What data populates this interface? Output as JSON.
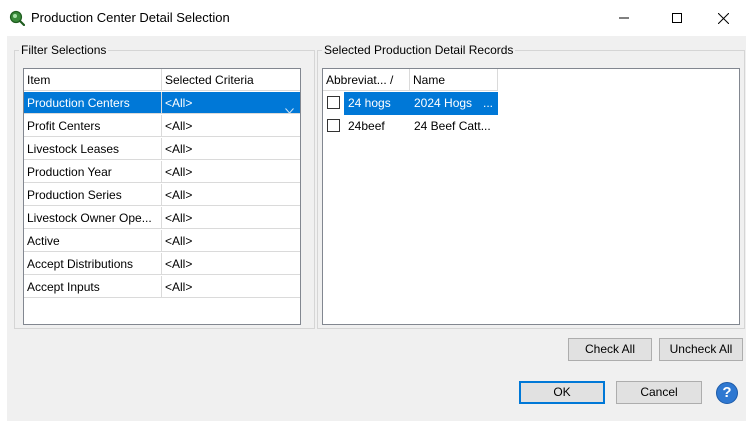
{
  "window": {
    "title": "Production Center Detail Selection",
    "icon": "search-icon",
    "controls": [
      "minimize-icon",
      "maximize-icon",
      "close-icon"
    ]
  },
  "filter_panel": {
    "title": "Filter Selections",
    "columns": [
      "Item",
      "Selected Criteria"
    ],
    "rows": [
      {
        "item": "Production Centers",
        "criteria": "<All>",
        "selected": true
      },
      {
        "item": "Profit Centers",
        "criteria": "<All>"
      },
      {
        "item": "Livestock Leases",
        "criteria": "<All>"
      },
      {
        "item": "Production Year",
        "criteria": "<All>"
      },
      {
        "item": "Production Series",
        "criteria": "<All>"
      },
      {
        "item": "Livestock Owner Ope...",
        "criteria": "<All>"
      },
      {
        "item": "Active",
        "criteria": "<All>"
      },
      {
        "item": "Accept Distributions",
        "criteria": "<All>"
      },
      {
        "item": "Accept Inputs",
        "criteria": "<All>"
      }
    ]
  },
  "records_panel": {
    "title": "Selected Production Detail Records",
    "columns": [
      "Abbreviat... /",
      "Name"
    ],
    "rows": [
      {
        "abbr": "24 hogs",
        "name": "2024 Hogs",
        "ellipsis": "...",
        "checked": false,
        "selected": true
      },
      {
        "abbr": "24beef",
        "name": "24 Beef Catt...",
        "checked": false,
        "selected": false
      }
    ]
  },
  "buttons": {
    "check_all": "Check All",
    "uncheck_all": "Uncheck All",
    "ok": "OK",
    "cancel": "Cancel",
    "help": "?"
  },
  "colors": {
    "selection": "#0078d7",
    "dialog_bg": "#f0f0f0",
    "default_button_border": "#0078d7"
  }
}
